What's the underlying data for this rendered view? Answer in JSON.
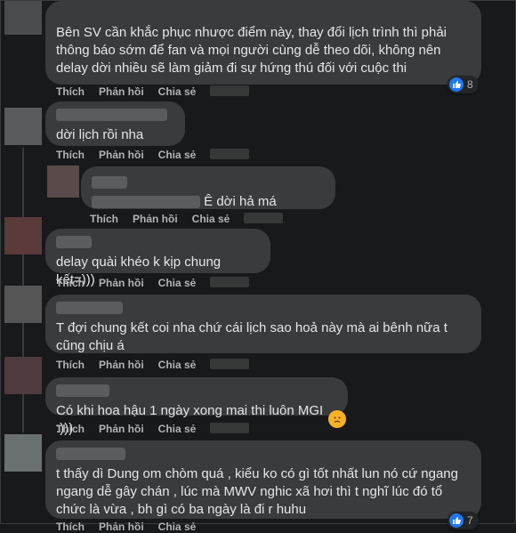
{
  "actions": {
    "like": "Thích",
    "reply": "Phản hồi",
    "share": "Chia sẻ"
  },
  "comments": [
    {
      "text": "Bên SV cần khắc phục nhược điểm này, thay đổi lịch trình thì phải thông báo sớm để fan và mọi người cùng dễ theo dõi, không nên delay dời nhiều sẽ làm giảm đi sự hứng thú đối với cuộc thi",
      "reactions": "8"
    },
    {
      "text": "dời lịch rồi nha"
    },
    {
      "text": "Ê dời hả má"
    },
    {
      "text": "delay quài khéo k kịp chung kết=)))"
    },
    {
      "text": "T đợi chung kết coi nha chứ cái lịch sao hoả này mà ai bênh nữa t cũng chịu á"
    },
    {
      "text": "Có khi hoa hậu 1 ngày xong mai thi luôn MGI :)))"
    },
    {
      "text": "t thấy dì Dung om chòm quá , kiểu ko có gì tốt nhất lun nó cứ ngang ngang dễ gây chán , lúc mà MWV nghic xã hơi thì t nghĩ lúc đó tổ chức là vừa , bh gì có ba ngày là đi r huhu",
      "reactions": "7"
    }
  ],
  "colors": {
    "background": "#18191a",
    "bubble": "#3a3b3c",
    "like": "#2078f4",
    "haha": "#f7b125"
  },
  "icons": {
    "like": "thumbs-up-icon",
    "haha": "sad-face-icon"
  }
}
